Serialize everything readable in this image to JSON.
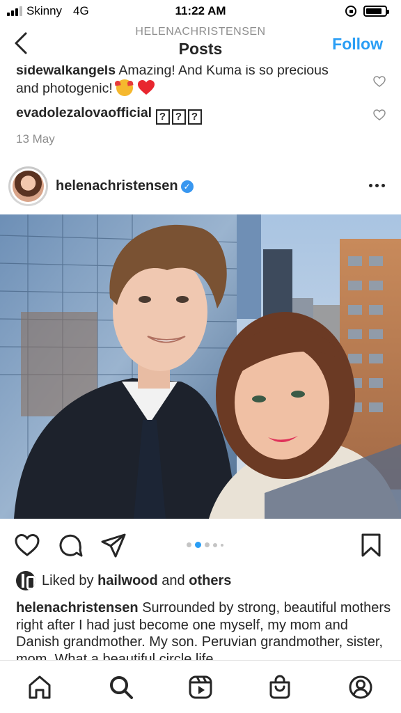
{
  "status_bar": {
    "carrier": "Skinny",
    "network": "4G",
    "time": "11:22 AM"
  },
  "header": {
    "account": "HELENACHRISTENSEN",
    "title": "Posts",
    "follow_label": "Follow"
  },
  "comments": [
    {
      "user": "sidewalkangels",
      "text": "Amazing! And Kuma is so precious and photogenic!"
    },
    {
      "user": "evadolezalova​official",
      "text": "???"
    }
  ],
  "comment_date": "13 May",
  "post": {
    "username": "helenachristensen",
    "verified_glyph": "✓",
    "carousel": {
      "count": 5,
      "active_index": 1
    },
    "liked_by_prefix": "Liked by",
    "liked_by_user": "hailwood",
    "liked_by_and": "and",
    "liked_by_others": "others",
    "caption_user": "helenachristensen",
    "caption_text": "Surrounded by strong, beautiful mothers right after I had just become one myself, my mom and Danish grandmother. My son. Peruvian grandmother, sister, mom.  What a beautiful circle life"
  },
  "icons": {
    "back": "chevron-left-icon",
    "comment_like": "heart-outline-icon",
    "more": "more-horizontal-icon",
    "like": "heart-icon",
    "comment": "comment-bubble-icon",
    "share": "paper-plane-icon",
    "save": "bookmark-icon",
    "tab_home": "home-icon",
    "tab_search": "search-icon",
    "tab_reels": "reels-icon",
    "tab_shop": "shopping-bag-icon",
    "tab_profile": "profile-icon"
  },
  "colors": {
    "follow": "#2a9ef5",
    "verified": "#3897f0",
    "carousel_active": "#2a9ef5",
    "text": "#262626",
    "muted": "#8e8e8e"
  }
}
